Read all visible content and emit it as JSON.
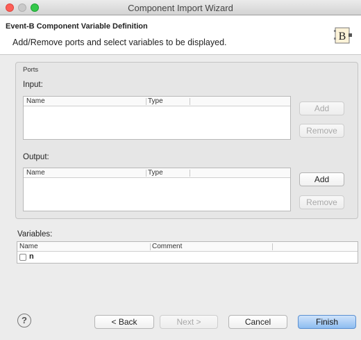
{
  "window": {
    "title": "Component Import Wizard"
  },
  "header": {
    "title": "Event-B Component Variable Definition",
    "description": "Add/Remove ports and select variables to be displayed.",
    "logo_letter": "B"
  },
  "ports": {
    "group_title": "Ports",
    "input": {
      "label": "Input:",
      "columns": [
        "Name",
        "Type"
      ],
      "add_label": "Add",
      "remove_label": "Remove"
    },
    "output": {
      "label": "Output:",
      "columns": [
        "Name",
        "Type"
      ],
      "add_label": "Add",
      "remove_label": "Remove"
    }
  },
  "variables": {
    "label": "Variables:",
    "columns": [
      "Name",
      "Comment"
    ],
    "rows": [
      {
        "name": "n",
        "checked": false
      }
    ]
  },
  "footer": {
    "help_glyph": "?",
    "back_label": "< Back",
    "next_label": "Next >",
    "cancel_label": "Cancel",
    "finish_label": "Finish"
  }
}
